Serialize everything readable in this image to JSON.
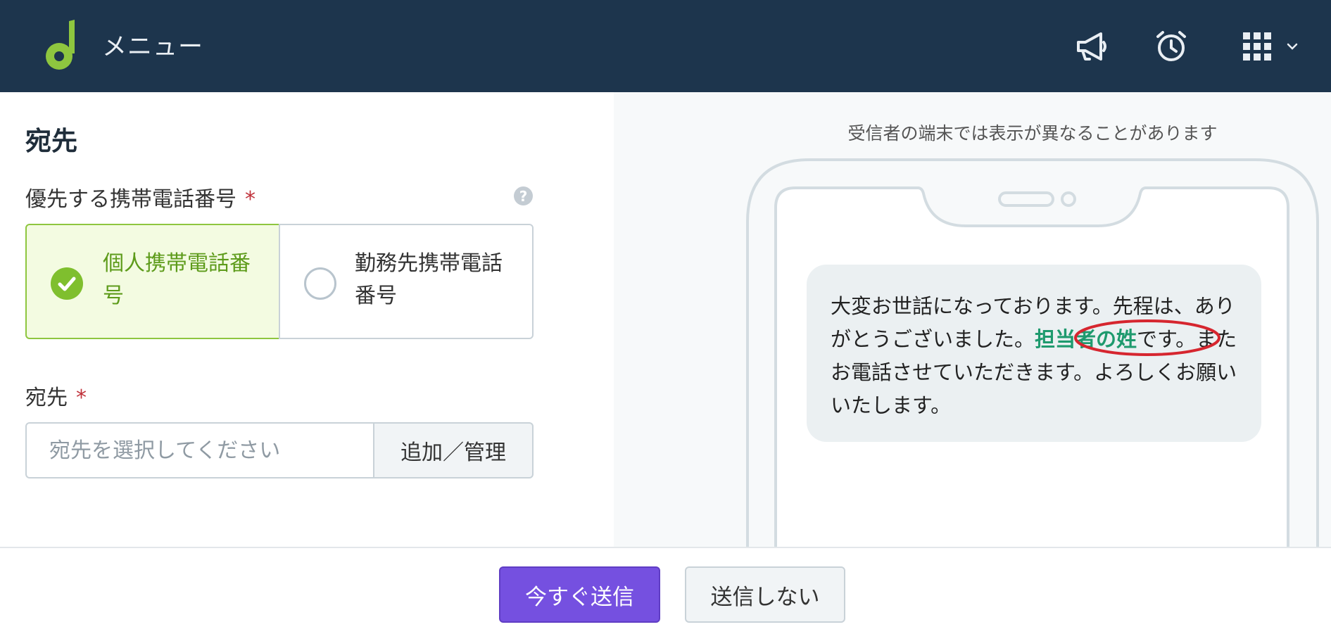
{
  "header": {
    "menu_label": "メニュー",
    "icons": [
      "logo-icon",
      "megaphone-icon",
      "alarm-clock-icon",
      "apps-grid-icon",
      "chevron-down-icon"
    ]
  },
  "form": {
    "section_title": "宛先",
    "phone_priority_label": "優先する携帯電話番号",
    "required_mark": "*",
    "help_mark": "?",
    "options": [
      {
        "label": "個人携帯電話番号",
        "selected": true
      },
      {
        "label": "勤務先携帯電話番号",
        "selected": false
      }
    ],
    "recipient_label": "宛先",
    "recipient_placeholder": "宛先を選択してください",
    "add_manage_label": "追加／管理"
  },
  "preview": {
    "note": "受信者の端末では表示が異なることがあります",
    "message_before": "大変お世話になっております。先程は、ありがとうございました。",
    "placeholder": "担当者の姓",
    "message_after": "です。またお電話させていただきます。よろしくお願いいたします。"
  },
  "footer": {
    "send_now_label": "今すぐ送信",
    "dont_send_label": "送信しない"
  },
  "colors": {
    "header_bg": "#1d354d",
    "accent_green": "#7fbf2e",
    "placeholder_green": "#1e9a6e",
    "send_purple": "#7550e0",
    "annotation_red": "#d6262f"
  }
}
